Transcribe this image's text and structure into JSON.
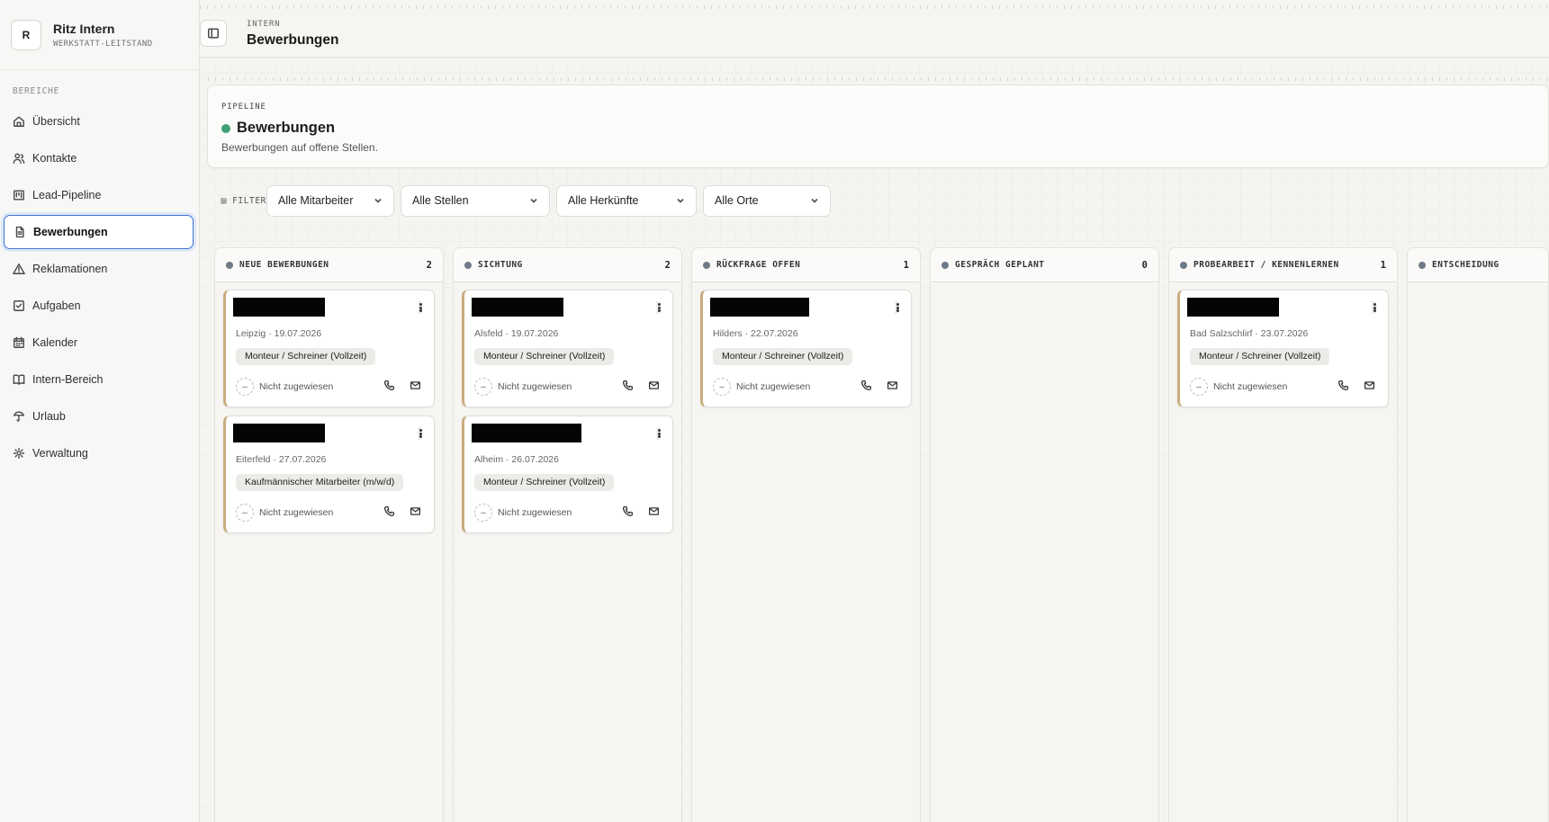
{
  "app": {
    "avatar": "R",
    "name": "Ritz Intern",
    "subtitle": "WERKSTATT-LEITSTAND"
  },
  "sidebar": {
    "section": "BEREICHE",
    "items": [
      {
        "label": "Übersicht",
        "icon": "home-icon"
      },
      {
        "label": "Kontakte",
        "icon": "users-icon"
      },
      {
        "label": "Lead-Pipeline",
        "icon": "kanban-icon"
      },
      {
        "label": "Bewerbungen",
        "icon": "file-icon",
        "active": true
      },
      {
        "label": "Reklamationen",
        "icon": "warning-icon"
      },
      {
        "label": "Aufgaben",
        "icon": "checkbox-icon"
      },
      {
        "label": "Kalender",
        "icon": "calendar-icon"
      },
      {
        "label": "Intern-Bereich",
        "icon": "book-icon"
      },
      {
        "label": "Urlaub",
        "icon": "umbrella-icon"
      },
      {
        "label": "Verwaltung",
        "icon": "gear-icon"
      }
    ]
  },
  "topbar": {
    "breadcrumb": "INTERN",
    "title": "Bewerbungen"
  },
  "pipeline": {
    "label": "PIPELINE",
    "title": "Bewerbungen",
    "description": "Bewerbungen auf offene Stellen.",
    "status_color": "#3ea073"
  },
  "filters": {
    "label": "FILTER",
    "employee": "Alle Mitarbeiter",
    "position": "Alle Stellen",
    "source": "Alle Herkünfte",
    "location": "Alle Orte"
  },
  "columns": [
    {
      "title": "NEUE BEWERBUNGEN",
      "count": "2",
      "cards": [
        {
          "meta": "Leipzig · 19.07.2026",
          "tag": "Monteur / Schreiner (Vollzeit)",
          "assignee": "Nicht zugewiesen",
          "assign_symbol": "–"
        },
        {
          "meta": "Eiterfeld · 27.07.2026",
          "tag": "Kaufmännischer Mitarbeiter (m/w/d)",
          "assignee": "Nicht zugewiesen",
          "assign_symbol": "–"
        }
      ]
    },
    {
      "title": "SICHTUNG",
      "count": "2",
      "cards": [
        {
          "meta": "Alsfeld · 19.07.2026",
          "tag": "Monteur / Schreiner (Vollzeit)",
          "assignee": "Nicht zugewiesen",
          "assign_symbol": "–"
        },
        {
          "meta": "Alheim · 26.07.2026",
          "tag": "Monteur / Schreiner (Vollzeit)",
          "assignee": "Nicht zugewiesen",
          "assign_symbol": "–"
        }
      ]
    },
    {
      "title": "RÜCKFRAGE OFFEN",
      "count": "1",
      "cards": [
        {
          "meta": "Hilders · 22.07.2026",
          "tag": "Monteur / Schreiner (Vollzeit)",
          "assignee": "Nicht zugewiesen",
          "assign_symbol": "–"
        }
      ]
    },
    {
      "title": "GESPRÄCH GEPLANT",
      "count": "0",
      "cards": []
    },
    {
      "title": "PROBEARBEIT / KENNENLERNEN",
      "count": "1",
      "cards": [
        {
          "meta": "Bad Salzschlirf · 23.07.2026",
          "tag": "Monteur / Schreiner (Vollzeit)",
          "assignee": "Nicht zugewiesen",
          "assign_symbol": "–"
        }
      ]
    },
    {
      "title": "ENTSCHEIDUNG",
      "count": "",
      "cards": []
    }
  ]
}
